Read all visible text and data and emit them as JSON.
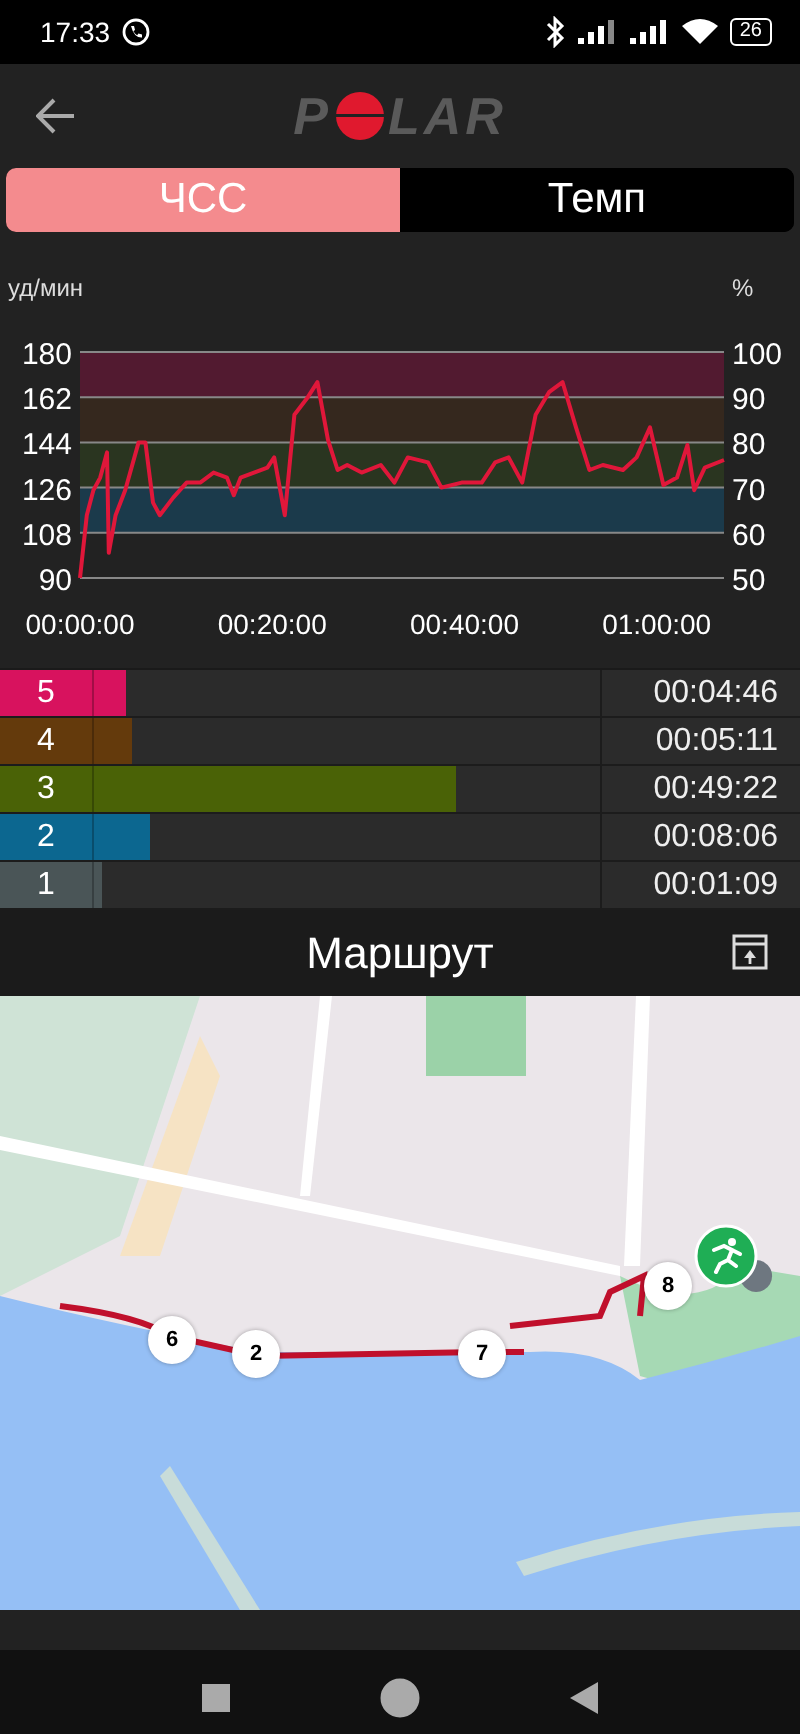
{
  "status_bar": {
    "time": "17:33",
    "battery": "26"
  },
  "header": {
    "logo": {
      "left": "P",
      "right": "LAR"
    }
  },
  "tabs": [
    {
      "label": "ЧСС",
      "selected": true
    },
    {
      "label": "Темп",
      "selected": false
    }
  ],
  "chart_data": {
    "type": "line",
    "ylabel": "уд/мин",
    "y2label": "%",
    "xlim": [
      0,
      67
    ],
    "ylim": [
      90,
      180
    ],
    "xticks": [
      {
        "value": 0,
        "label": "00:00:00"
      },
      {
        "value": 20,
        "label": "00:20:00"
      },
      {
        "value": 40,
        "label": "00:40:00"
      },
      {
        "value": 60,
        "label": "01:00:00"
      }
    ],
    "yticks": [
      90,
      108,
      126,
      144,
      162,
      180
    ],
    "y2lim": [
      50,
      100
    ],
    "y2ticks": [
      50,
      60,
      70,
      80,
      90,
      100
    ],
    "grid": true,
    "bands": [
      {
        "axis": "y",
        "from": 108,
        "to": 126,
        "color": "#1b3a4b"
      },
      {
        "axis": "y",
        "from": 126,
        "to": 144,
        "color": "#2a3520"
      },
      {
        "axis": "y",
        "from": 144,
        "to": 162,
        "color": "#35281e"
      },
      {
        "axis": "y",
        "from": 162,
        "to": 180,
        "color": "#521a30"
      }
    ],
    "x": [
      0,
      0.7,
      1.4,
      2.1,
      2.8,
      3,
      3.7,
      4.7,
      6.1,
      6.8,
      7.6,
      8.3,
      9.7,
      11.1,
      12.5,
      13.9,
      15.3,
      16,
      16.7,
      18.1,
      19.5,
      20.2,
      21.3,
      22.3,
      23.7,
      24.7,
      25.8,
      26.8,
      27.8,
      29.3,
      31.3,
      32.7,
      34.1,
      36.2,
      37.6,
      39.7,
      41.8,
      43.2,
      44.6,
      46,
      47.4,
      48.8,
      50.2,
      51.6,
      53,
      54.4,
      56.5,
      57.9,
      59.3,
      60.7,
      62.1,
      63.2,
      63.9,
      65,
      67
    ],
    "series": [
      {
        "color": "#e0173a",
        "values": [
          90,
          115,
          125,
          130,
          140,
          100,
          115,
          125,
          144,
          144,
          120,
          115,
          122,
          128,
          128,
          132,
          130,
          123,
          130,
          132,
          134,
          138,
          115,
          155,
          162,
          168,
          145,
          133,
          135,
          132,
          135,
          128,
          138,
          136,
          126,
          128,
          128,
          136,
          138,
          128,
          155,
          164,
          168,
          150,
          133,
          135,
          133,
          138,
          150,
          127,
          130,
          143,
          125,
          134,
          137
        ]
      }
    ]
  },
  "zones": [
    {
      "label": "5",
      "time": "00:04:46",
      "color": "#d8125e",
      "level": 0.21
    },
    {
      "label": "4",
      "time": "00:05:11",
      "color": "#643a0c",
      "level": 0.22
    },
    {
      "label": "3",
      "time": "00:49:22",
      "color": "#4a6206",
      "level": 0.76
    },
    {
      "label": "2",
      "time": "00:08:06",
      "color": "#0c6790",
      "level": 0.25
    },
    {
      "label": "1",
      "time": "00:01:09",
      "color": "#4a5557",
      "level": 0.17
    }
  ],
  "route": {
    "title": "Маршрут",
    "markers": [
      "6",
      "2",
      "7",
      "8"
    ]
  }
}
